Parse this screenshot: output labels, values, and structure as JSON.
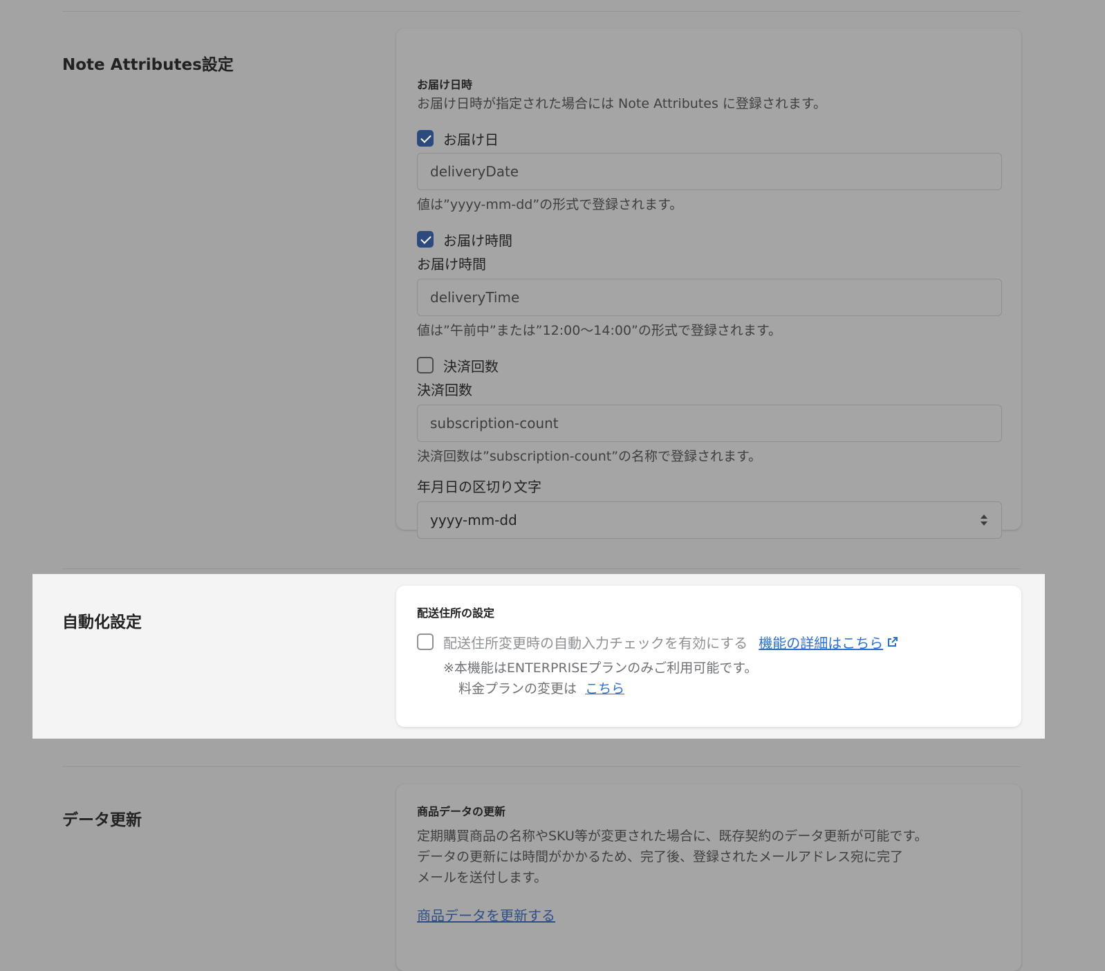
{
  "note_attributes": {
    "title": "Note Attributes設定",
    "card_heading": "お届け日時",
    "card_description": "お届け日時が指定された場合には Note Attributes に登録されます。",
    "delivery_date": {
      "checkbox_label": "お届け日",
      "checked": true,
      "input_placeholder": "deliveryDate",
      "help_text": "値は”yyyy-mm-dd”の形式で登録されます。"
    },
    "delivery_time": {
      "checkbox_label": "お届け時間",
      "checked": true,
      "field_label": "お届け時間",
      "input_placeholder": "deliveryTime",
      "help_text": "値は”午前中”または”12:00〜14:00”の形式で登録されます。"
    },
    "subscription_count": {
      "checkbox_label": "決済回数",
      "checked": false,
      "field_label": "決済回数",
      "input_placeholder": "subscription-count",
      "help_text": "決済回数は”subscription-count”の名称で登録されます。"
    },
    "date_separator": {
      "field_label": "年月日の区切り文字",
      "selected": "yyyy-mm-dd"
    }
  },
  "automation": {
    "title": "自動化設定",
    "card_heading": "配送住所の設定",
    "checkbox_label": "配送住所変更時の自動入力チェックを有効にする",
    "checked": false,
    "details_link": "機能の詳細はこちら",
    "note_line1": "※本機能はENTERPRISEプランのみご利用可能です。",
    "note_line2_prefix": "料金プランの変更は",
    "plan_link": "こちら"
  },
  "data_update": {
    "title": "データ更新",
    "card_heading": "商品データの更新",
    "description_lines": [
      "定期購買商品の名称やSKU等が変更された場合に、既存契約のデータ更新が可能です。",
      "データの更新には時間がかかるため、完了後、登録されたメールアドレス宛に完了",
      "メールを送付します。"
    ],
    "update_link": "商品データを更新する"
  },
  "colors": {
    "overlay_background": "#a3a3a3",
    "highlight_background": "#f4f4f4",
    "checkbox_checked": "#2c4a7e",
    "link": "#2c6ecb"
  }
}
